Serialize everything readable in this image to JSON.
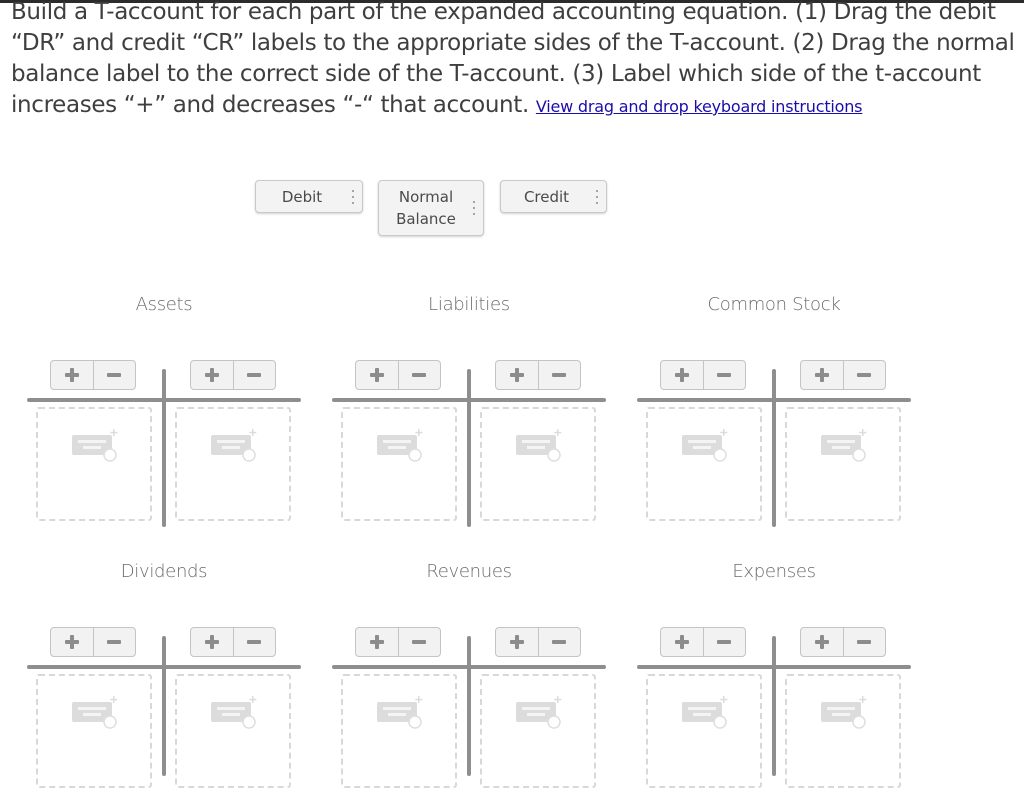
{
  "instructions": {
    "text": "Build a T-account for each part of the expanded accounting equation. (1) Drag the debit “DR” and credit “CR” labels to the appropriate sides of the T-account. (2) Drag the normal balance label to the correct side of the T-account. (3) Label which side of the t-account increases “+” and decreases “-“ that account.",
    "link_label": "View drag and drop keyboard instructions"
  },
  "draggables": [
    {
      "label": "Debit",
      "icon": "drag-handle-icon"
    },
    {
      "label": "Normal Balance",
      "icon": "drag-handle-icon"
    },
    {
      "label": "Credit",
      "icon": "drag-handle-icon"
    }
  ],
  "sign_toggle": {
    "plus": "+",
    "minus": "−"
  },
  "drop_zone_icon": "add-label-icon",
  "accounts": [
    {
      "title": "Assets"
    },
    {
      "title": "Liabilities"
    },
    {
      "title": "Common Stock"
    },
    {
      "title": "Dividends"
    },
    {
      "title": "Revenues"
    },
    {
      "title": "Expenses"
    }
  ],
  "colors": {
    "link": "#1a0dab",
    "t_bar": "#8e8e8e",
    "dashed_border": "#d8d8d8"
  }
}
